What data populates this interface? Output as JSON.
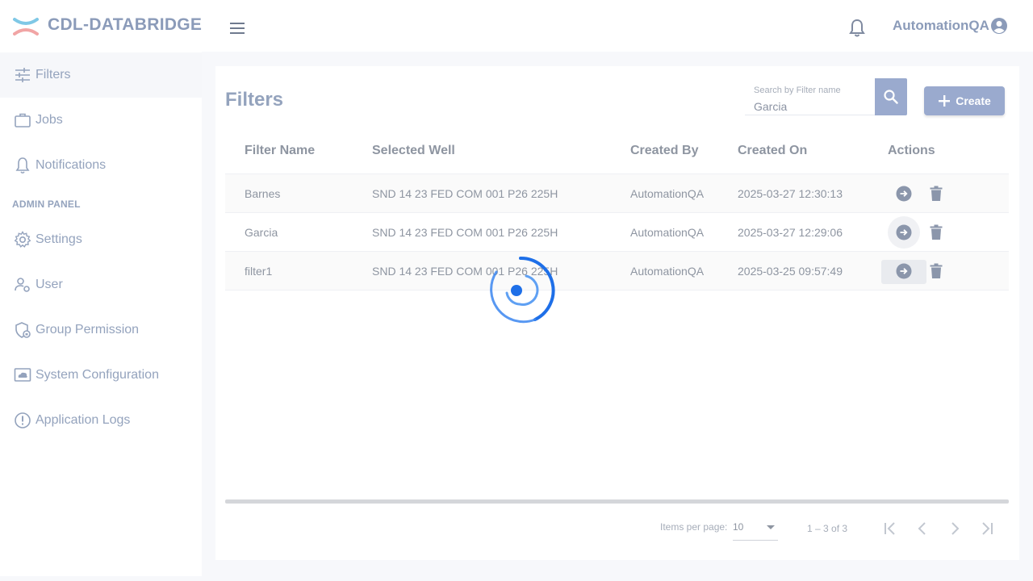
{
  "header": {
    "brand": "CDL-DATABRIDGE",
    "user_name": "AutomationQA",
    "icons": [
      "menu-icon",
      "bell-icon",
      "account-circle-icon"
    ]
  },
  "sidebar": {
    "items": [
      {
        "label": "Filters",
        "icon": "tune-icon",
        "active": true
      },
      {
        "label": "Jobs",
        "icon": "briefcase-icon"
      },
      {
        "label": "Notifications",
        "icon": "bell-icon"
      }
    ],
    "admin_heading": "ADMIN PANEL",
    "admin_items": [
      {
        "label": "Settings",
        "icon": "gear-icon"
      },
      {
        "label": "User",
        "icon": "user-settings-icon"
      },
      {
        "label": "Group Permission",
        "icon": "shield-lock-icon"
      },
      {
        "label": "System Configuration",
        "icon": "cloud-monitor-icon"
      },
      {
        "label": "Application Logs",
        "icon": "alert-circle-icon"
      }
    ]
  },
  "main": {
    "title": "Filters",
    "search": {
      "label": "Search by Filter name",
      "value": "Garcia"
    },
    "create_label": "Create",
    "table": {
      "columns": [
        "Filter Name",
        "Selected Well",
        "Created By",
        "Created On",
        "Actions"
      ],
      "rows": [
        {
          "name": "Barnes",
          "well": "SND 14 23 FED COM 001 P26 225H",
          "created_by": "AutomationQA",
          "created_on": "2025-03-27 12:30:13"
        },
        {
          "name": "Garcia",
          "well": "SND 14 23 FED COM 001 P26 225H",
          "created_by": "AutomationQA",
          "created_on": "2025-03-27 12:29:06"
        },
        {
          "name": "filter1",
          "well": "SND 14 23 FED COM 001 P26 225H",
          "created_by": "AutomationQA",
          "created_on": "2025-03-25 09:57:49"
        }
      ]
    },
    "paginator": {
      "items_per_page_label": "Items per page:",
      "items_per_page": "10",
      "range": "1 – 3 of 3"
    }
  },
  "colors": {
    "accent": "#9aaace",
    "brand_text": "#8b9bb9",
    "spinner": "#1e6fe8",
    "logo_top": "#7fc8e6",
    "logo_bottom": "#f1a5a5"
  }
}
